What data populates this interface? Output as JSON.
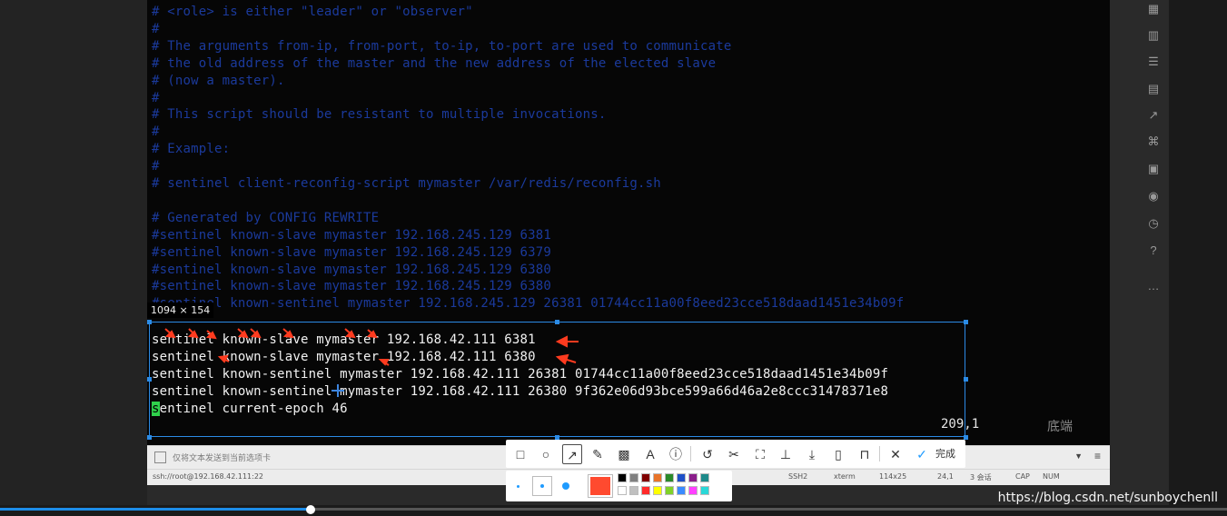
{
  "terminal": {
    "dim_lines": [
      "# <role> is either \"leader\" or \"observer\"",
      "#",
      "# The arguments from-ip, from-port, to-ip, to-port are used to communicate",
      "# the old address of the master and the new address of the elected slave",
      "# (now a master).",
      "#",
      "# This script should be resistant to multiple invocations.",
      "#",
      "# Example:",
      "#",
      "# sentinel client-reconfig-script mymaster /var/redis/reconfig.sh",
      "",
      "# Generated by CONFIG REWRITE",
      "#sentinel known-slave mymaster 192.168.245.129 6381",
      "#sentinel known-slave mymaster 192.168.245.129 6379",
      "#sentinel known-slave mymaster 192.168.245.129 6380",
      "#sentinel known-slave mymaster 192.168.245.129 6380",
      "#sentinel known-sentinel mymaster 192.168.245.129 26381 01744cc11a00f8eed23cce518daad1451e34b09f"
    ],
    "bright_lines": [
      "sentinel known-slave mymaster 192.168.42.111 6381",
      "sentinel known-slave mymaster 192.168.42.111 6380",
      "sentinel known-sentinel mymaster 192.168.42.111 26381 01744cc11a00f8eed23cce518daad1451e34b09f",
      "sentinel known-sentinel mymaster 192.168.42.111 26380 9f362e06d93bce599a66d46a2e8ccc31478371e8"
    ],
    "cursor_char": "s",
    "last_line_rest": "entinel current-epoch 46",
    "position": "209,1",
    "position_suffix": "底端"
  },
  "selection": {
    "size_label": "1094 × 154"
  },
  "input_bar": {
    "placeholder": "仅将文本发送到当前选项卡"
  },
  "status_bar": {
    "connection": "ssh://root@192.168.42.111:22",
    "protocol": "SSH2",
    "term": "xterm",
    "size": "114x25",
    "cursor": "24,1",
    "sessions": "3 会话",
    "cap": "CAP",
    "num": "NUM"
  },
  "toolbar": {
    "tools": [
      "rectangle-icon",
      "ellipse-icon",
      "arrow-icon",
      "pen-icon",
      "mosaic-icon",
      "text-icon",
      "serial-number-icon",
      "undo-icon",
      "cut-icon",
      "crop-icon",
      "pin-icon",
      "download-icon",
      "long-screenshot-icon",
      "bookmark-icon",
      "close-icon"
    ],
    "done_label": "完成",
    "selected_color": "#ff4a2f",
    "palette_top": [
      "#000000",
      "#808080",
      "#800000",
      "#e8742a",
      "#2a8a2a",
      "#1e50c8",
      "#8a1e8a",
      "#1e8a8a"
    ],
    "palette_bottom": [
      "#ffffff",
      "#c0c0c0",
      "#ff2a2a",
      "#ffff00",
      "#7fd12a",
      "#3a8bff",
      "#ff40ff",
      "#2ad8d8"
    ]
  },
  "video": {
    "progress": 0.253
  },
  "watermark": "https://blog.csdn.net/sunboychenll"
}
